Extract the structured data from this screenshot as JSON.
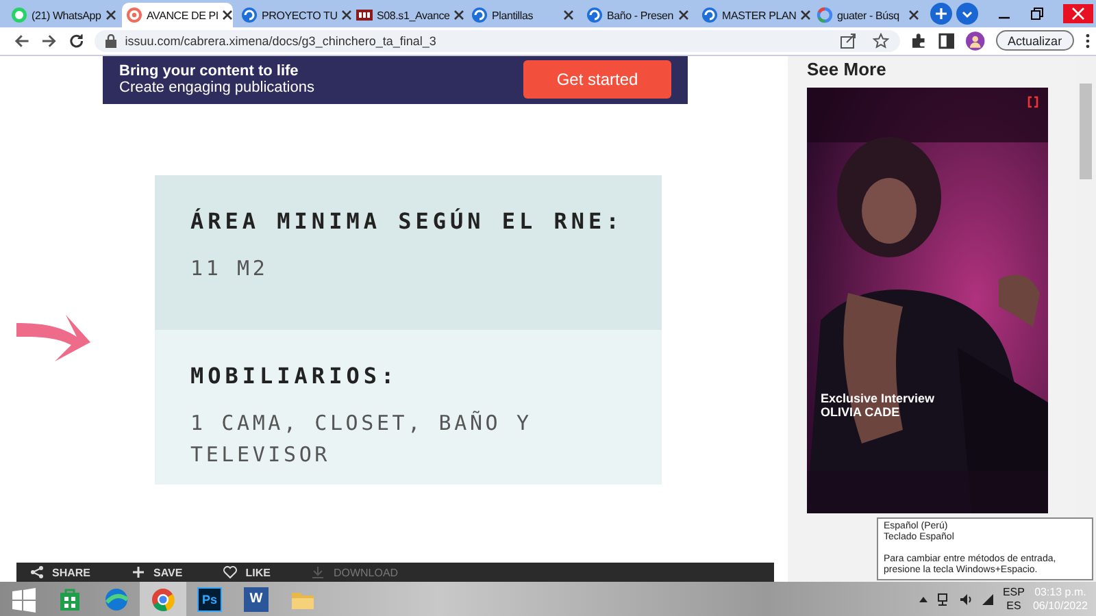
{
  "browser": {
    "tabs": [
      {
        "title": "(21) WhatsApp",
        "kind": "chat",
        "selected": false
      },
      {
        "title": "AVANCE DE PI",
        "kind": "ring",
        "selected": true
      },
      {
        "title": "PROYECTO TU",
        "kind": "swirl",
        "selected": false
      },
      {
        "title": "S08.s1_Avance",
        "kind": "film",
        "selected": false
      },
      {
        "title": "Plantillas",
        "kind": "swirl",
        "selected": false
      },
      {
        "title": "Baño - Presen",
        "kind": "swirl",
        "selected": false
      },
      {
        "title": "MASTER PLAN",
        "kind": "swirl",
        "selected": false
      },
      {
        "title": "guater - Búsq",
        "kind": "google",
        "selected": false
      }
    ],
    "url": "issuu.com/cabrera.ximena/docs/g3_chinchero_ta_final_3",
    "update_button": "Actualizar"
  },
  "banner": {
    "headline": "Bring your content to life",
    "subline": "Create engaging publications",
    "button": "Get started"
  },
  "card": {
    "sections": [
      {
        "heading": "ÁREA MINIMA SEGÚN EL RNE:",
        "value": "11 M2",
        "highlighted": true
      },
      {
        "heading": "MOBILIARIOS:",
        "value": "1 CAMA, CLOSET, BAÑO Y TELEVISOR",
        "highlighted": false
      }
    ]
  },
  "action_bar": [
    {
      "kind": "share",
      "label": "SHARE",
      "disabled": false
    },
    {
      "kind": "save",
      "label": "SAVE",
      "disabled": false
    },
    {
      "kind": "like",
      "label": "LIKE",
      "disabled": false
    },
    {
      "kind": "download",
      "label": "DOWNLOAD",
      "disabled": true
    }
  ],
  "sidebar": {
    "heading": "See More",
    "feature": {
      "kind": "picture",
      "caption": "Exclusive Interview",
      "name": "OLIVIA CADE"
    }
  },
  "tooltip": {
    "lines": [
      "Español (Perú)",
      "Teclado Español"
    ],
    "note": "Para cambiar entre métodos de entrada, presione la tecla Windows+Espacio."
  },
  "taskbar": {
    "apps": [
      {
        "kind": "windows",
        "active": false
      },
      {
        "kind": "store",
        "active": false
      },
      {
        "kind": "edge",
        "active": false
      },
      {
        "kind": "chrome",
        "active": true
      },
      {
        "kind": "photoshop",
        "label": "Ps",
        "active": false
      },
      {
        "kind": "word",
        "label": "W",
        "active": false
      },
      {
        "kind": "folder",
        "active": false
      }
    ],
    "language": [
      "ESP",
      "ES"
    ],
    "time": "03:13 p.m.",
    "date": "06/10/2022"
  }
}
